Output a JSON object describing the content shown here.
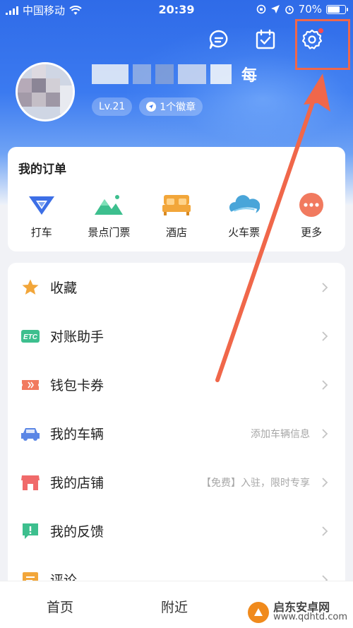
{
  "status_bar": {
    "carrier": "中国移动",
    "time": "20:39",
    "battery": "70%",
    "battery_level": 0.7
  },
  "header": {
    "icons": [
      "message-icon",
      "checkin-icon",
      "gear-icon"
    ],
    "username_suffix": "每",
    "level": "Lv.21",
    "badge_count": "1个徽章"
  },
  "orders": {
    "title": "我的订单",
    "items": [
      {
        "label": "打车",
        "icon": "taxi-icon",
        "color": "#3d6fe6"
      },
      {
        "label": "景点门票",
        "icon": "mountain-icon",
        "color": "#3dbf8e"
      },
      {
        "label": "酒店",
        "icon": "bed-icon",
        "color": "#f2a63a"
      },
      {
        "label": "火车票",
        "icon": "train-cloud-icon",
        "color": "#49a5d9"
      },
      {
        "label": "更多",
        "icon": "more-icon",
        "color": "#f17a5f"
      }
    ]
  },
  "menu": {
    "items": [
      {
        "label": "收藏",
        "hint": "",
        "icon": "star-icon"
      },
      {
        "label": "对账助手",
        "hint": "",
        "icon": "etc-icon"
      },
      {
        "label": "钱包卡券",
        "hint": "",
        "icon": "ticket-icon"
      },
      {
        "label": "我的车辆",
        "hint": "添加车辆信息",
        "icon": "car-icon"
      },
      {
        "label": "我的店铺",
        "hint": "【免费】入驻，限时专享",
        "icon": "shop-icon"
      },
      {
        "label": "我的反馈",
        "hint": "",
        "icon": "feedback-icon"
      },
      {
        "label": "评论",
        "hint": "",
        "icon": "comment-icon"
      }
    ],
    "etc_text": "ETC"
  },
  "tab_bar": {
    "tabs": [
      "首页",
      "附近"
    ]
  },
  "watermark": {
    "name": "启东安卓网",
    "url": "www.qdhtd.com"
  },
  "colors": {
    "accent_blue": "#3b7af0",
    "annotation": "#f0674a"
  }
}
